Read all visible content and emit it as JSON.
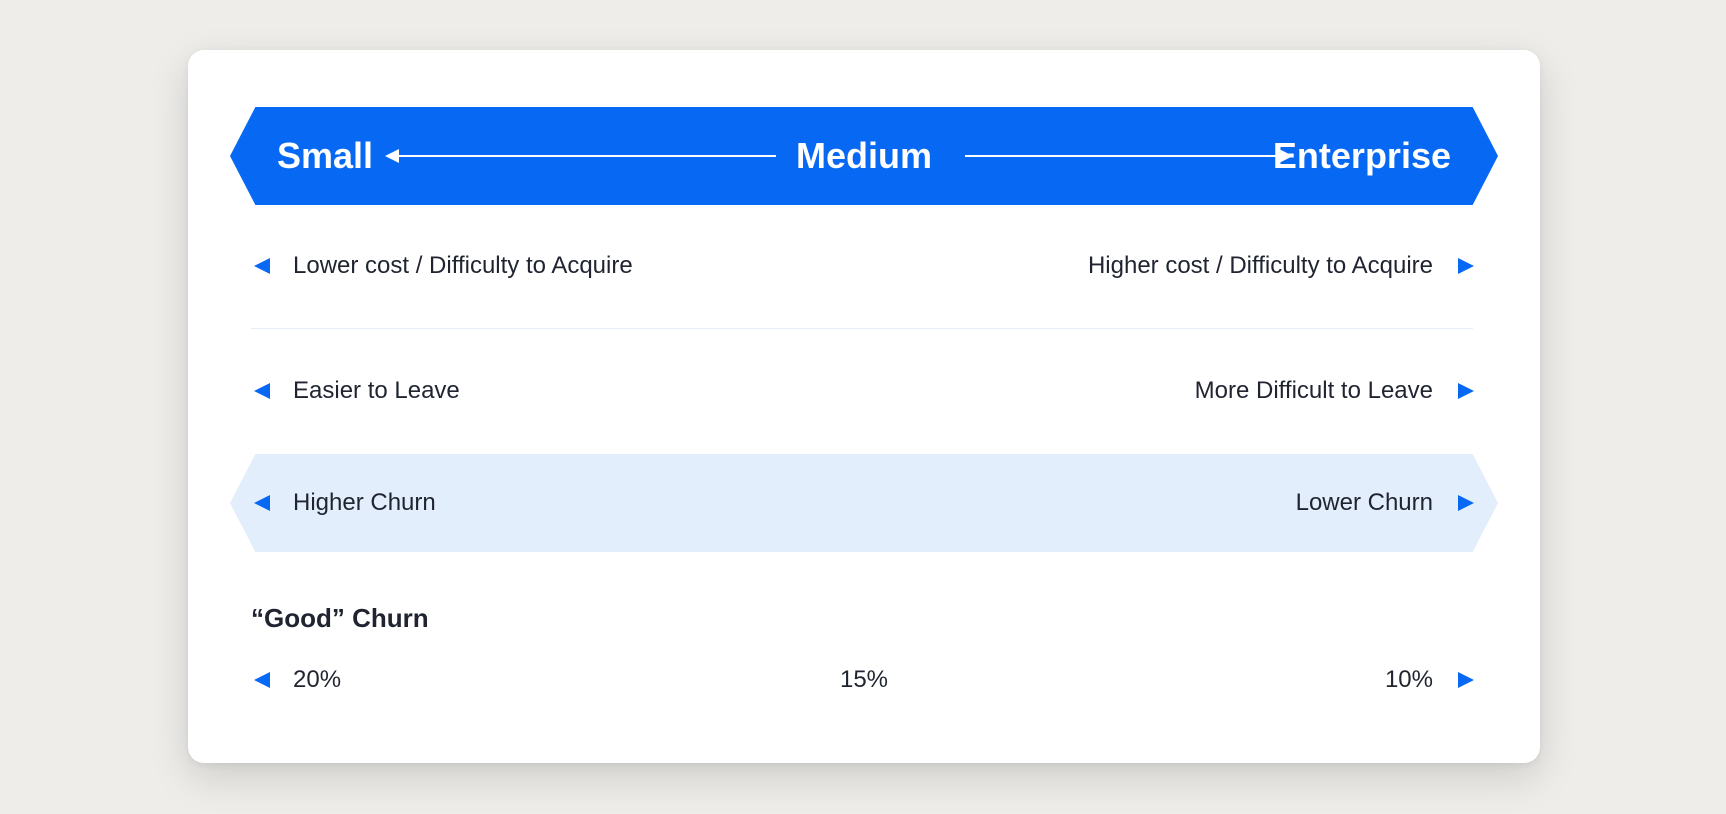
{
  "header": {
    "left_label": "Small",
    "center_label": "Medium",
    "right_label": "Enterprise"
  },
  "rows": [
    {
      "left": "Lower cost / Difficulty to Acquire",
      "right": "Higher cost / Difficulty to Acquire"
    },
    {
      "left": "Easier to Leave",
      "right": "More Difficult to Leave"
    },
    {
      "left": "Higher Churn",
      "right": "Lower Churn"
    }
  ],
  "good_churn": {
    "title": "“Good” Churn",
    "left_value": "20%",
    "center_value": "15%",
    "right_value": "10%"
  },
  "colors": {
    "accent": "#0768f4",
    "highlight": "#e3eefc",
    "background": "#eeedea",
    "card": "#ffffff"
  }
}
